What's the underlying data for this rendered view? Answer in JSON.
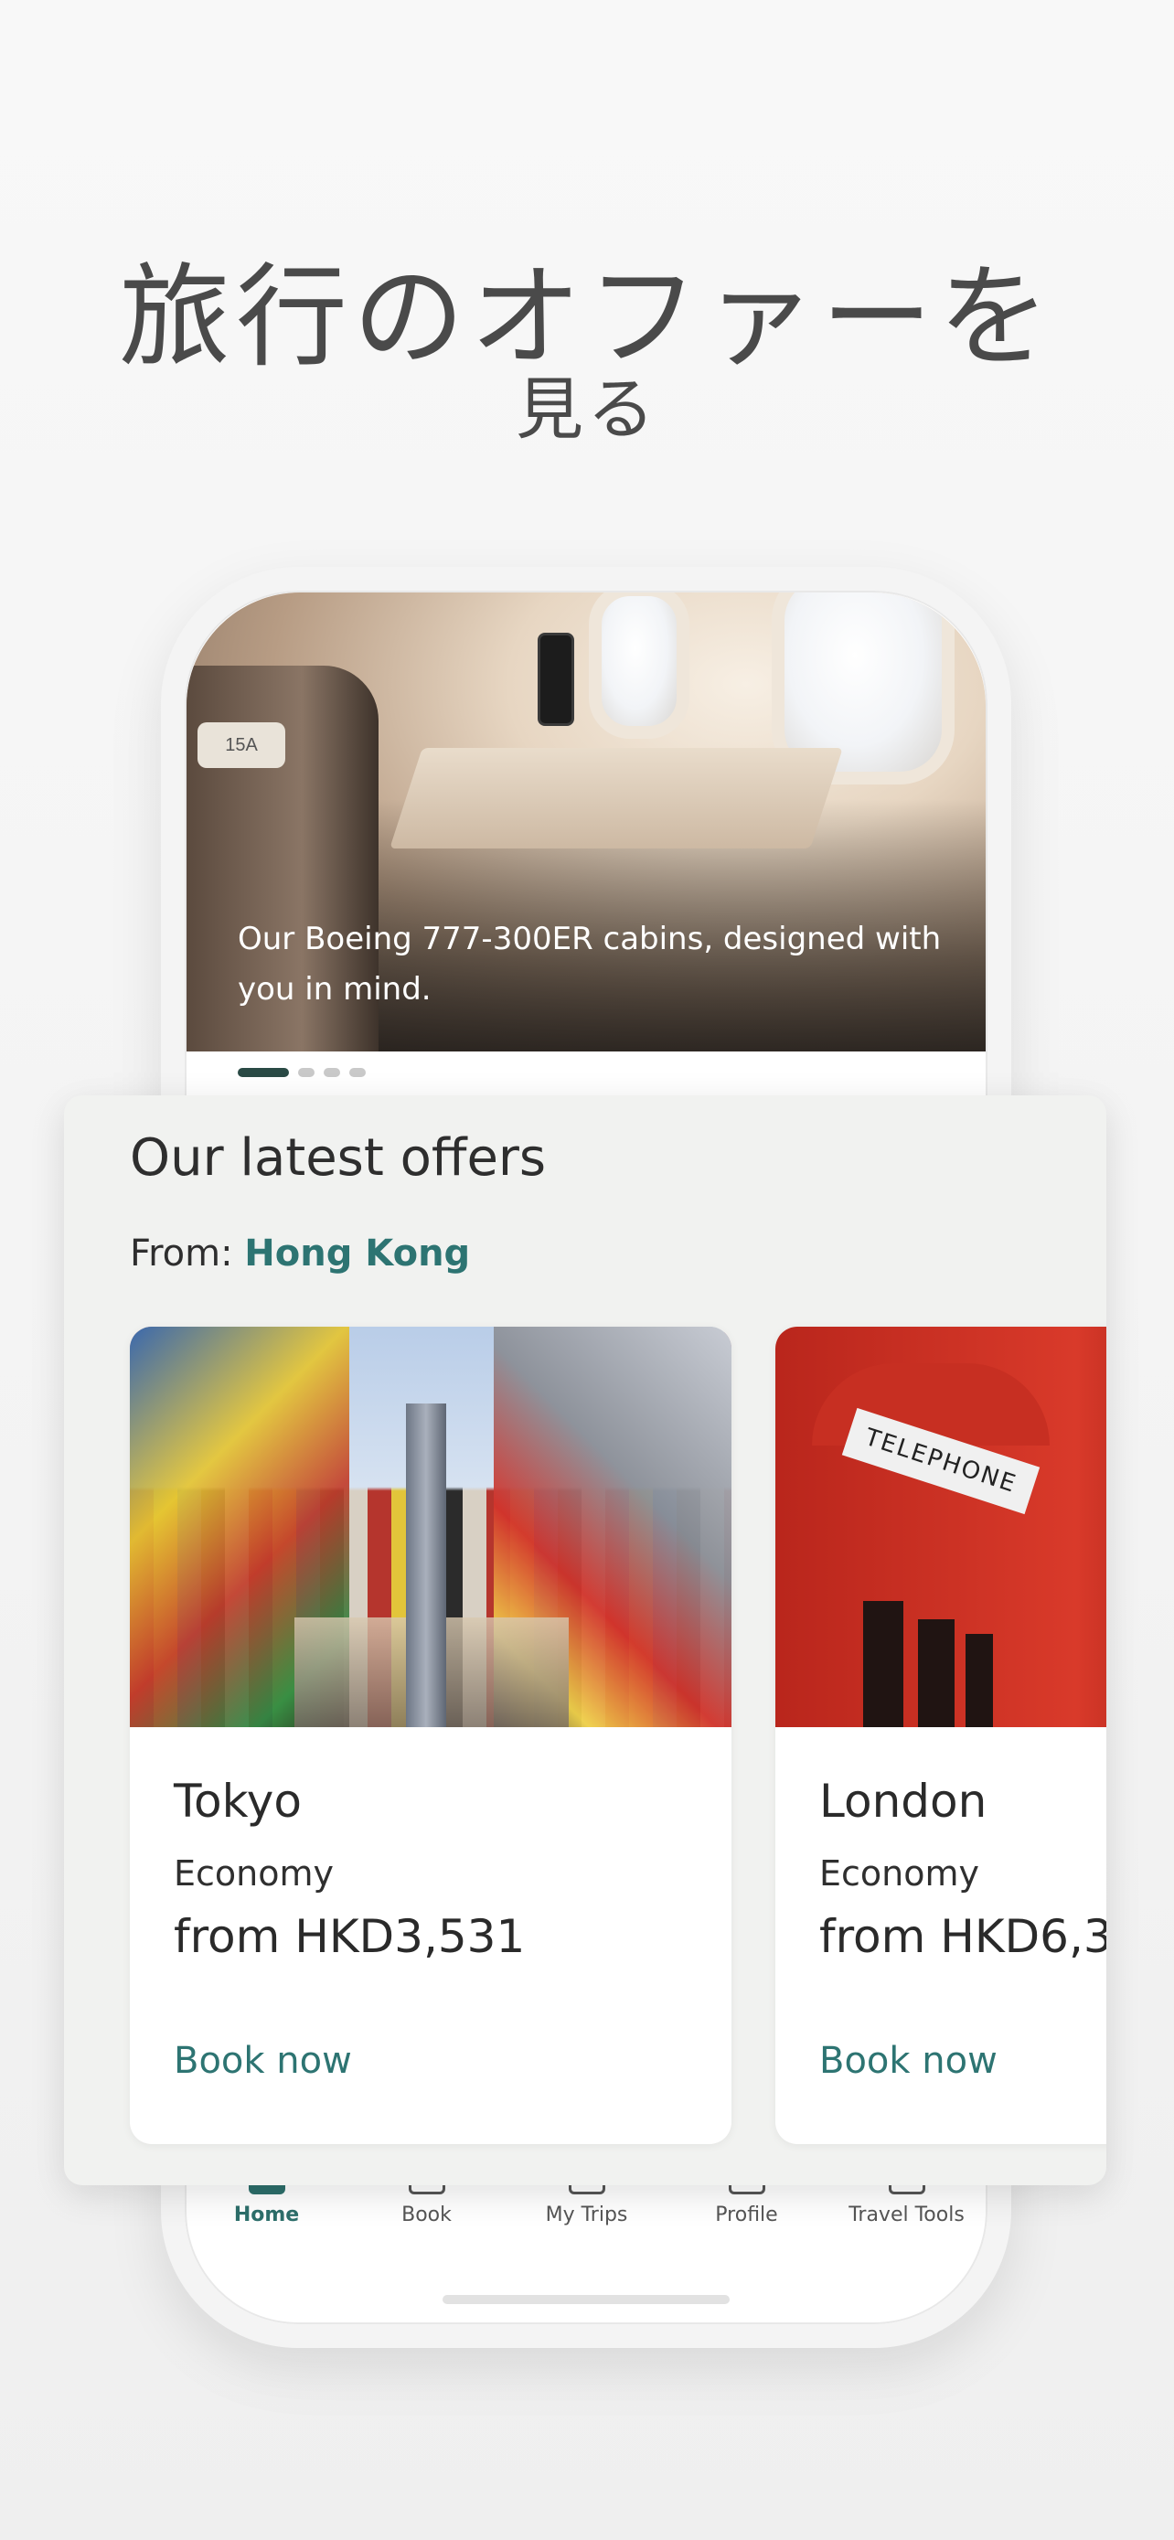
{
  "headline": {
    "line1": "旅行のオファーを",
    "line2": "見る"
  },
  "hero": {
    "caption": "Our Boeing 777-300ER cabins, designed with you in mind.",
    "seat_label": "15A",
    "carousel_pages": 4,
    "active_page": 1
  },
  "offers": {
    "title": "Our latest offers",
    "from_label": "From:",
    "from_city": "Hong Kong",
    "cards": [
      {
        "destination": "Tokyo",
        "cabin": "Economy",
        "price": "from HKD3,531",
        "cta": "Book now"
      },
      {
        "destination": "London",
        "cabin": "Economy",
        "price": "from HKD6,3",
        "cta": "Book now",
        "sign": "TELEPHONE"
      }
    ]
  },
  "tabbar": {
    "items": [
      {
        "label": "Home",
        "icon": "home-icon",
        "active": true
      },
      {
        "label": "Book",
        "icon": "plane-icon",
        "active": false
      },
      {
        "label": "My Trips",
        "icon": "trips-icon",
        "active": false
      },
      {
        "label": "Profile",
        "icon": "profile-icon",
        "active": false
      },
      {
        "label": "Travel Tools",
        "icon": "tools-icon",
        "active": false
      }
    ]
  },
  "colors": {
    "accent": "#2d7472",
    "active_tab": "#2d6f6b",
    "indicator": "#2a4a45"
  }
}
